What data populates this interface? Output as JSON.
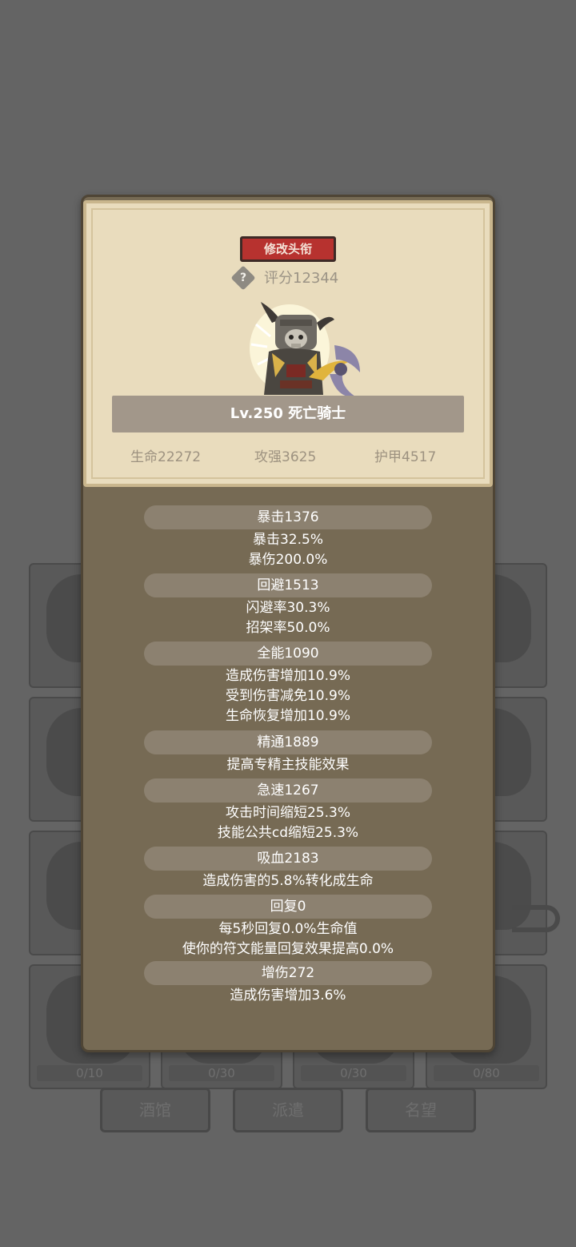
{
  "background": {
    "card_counts": [
      "0/10",
      "0/30",
      "0/30",
      "0/80"
    ],
    "buttons": [
      "酒馆",
      "派遣",
      "名望"
    ]
  },
  "profile": {
    "edit_title_label": "修改头衔",
    "help_glyph": "?",
    "score_label": "评分12344",
    "name_label": "Lv.250 死亡骑士",
    "stats": {
      "hp": "生命22272",
      "attack": "攻强3625",
      "armor": "护甲4517"
    }
  },
  "attributes": {
    "crit": {
      "header": "暴击1376",
      "lines": [
        "暴击32.5%",
        "暴伤200.0%"
      ]
    },
    "dodge": {
      "header": "回避1513",
      "lines": [
        "闪避率30.3%",
        "招架率50.0%"
      ]
    },
    "versatility": {
      "header": "全能1090",
      "lines": [
        "造成伤害增加10.9%",
        "受到伤害减免10.9%",
        "生命恢复增加10.9%"
      ]
    },
    "mastery": {
      "header": "精通1889",
      "lines": [
        "提高专精主技能效果"
      ]
    },
    "haste": {
      "header": "急速1267",
      "lines": [
        "攻击时间缩短25.3%",
        "技能公共cd缩短25.3%"
      ]
    },
    "lifesteal": {
      "header": "吸血2183",
      "lines": [
        "造成伤害的5.8%转化成生命"
      ]
    },
    "regen": {
      "header": "回复0",
      "lines": [
        "每5秒回复0.0%生命值",
        "使你的符文能量回复效果提高0.0%"
      ]
    },
    "damage_bonus": {
      "header": "增伤272",
      "lines": [
        "造成伤害增加3.6%"
      ]
    }
  },
  "colors": {
    "overlay": "#646464",
    "panel": "#766a54",
    "parchment": "#e9dcbd",
    "title_button": "#b7322f",
    "attr_header": "#8c8170"
  }
}
